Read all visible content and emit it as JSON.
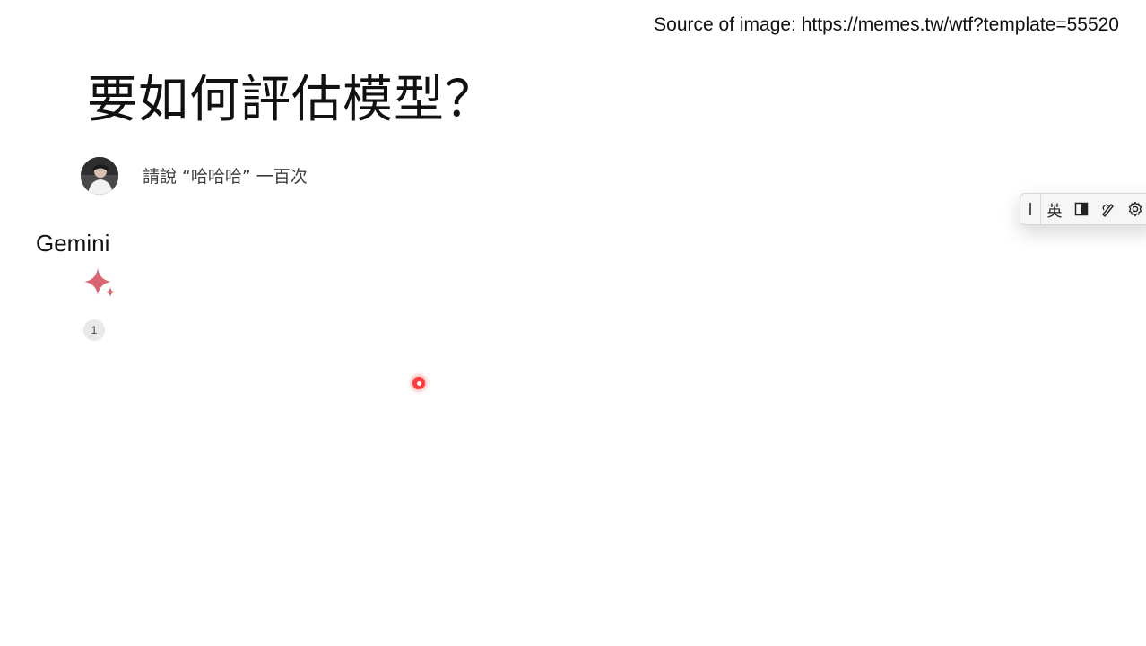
{
  "source_text": "Source of image: https://memes.tw/wtf?template=55520",
  "slide": {
    "title": "要如何評估模型？"
  },
  "chat": {
    "prompt": "請說 “哈哈哈” 一百次",
    "model_name": "Gemini",
    "counter": "1",
    "accent_color": "#d96570"
  },
  "ime_toolbar": {
    "language_label": "英",
    "icons": [
      "drag-handle-icon",
      "half-width-icon",
      "handwriting-icon",
      "gear-icon"
    ]
  }
}
